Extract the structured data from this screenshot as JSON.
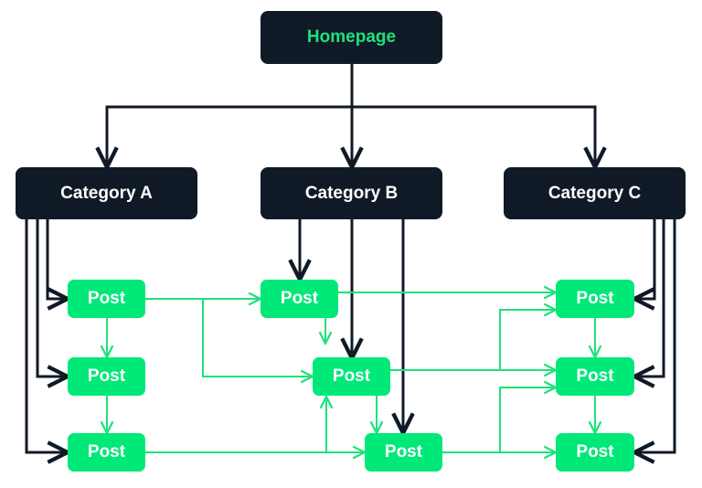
{
  "colors": {
    "dark": "#101a27",
    "green": "#00e878",
    "home_text": "#1ee27a"
  },
  "nodes": {
    "homepage": "Homepage",
    "category_a": "Category A",
    "category_b": "Category B",
    "category_c": "Category C",
    "post_label": "Post"
  },
  "posts": [
    {
      "id": "a1",
      "label": "Post"
    },
    {
      "id": "a2",
      "label": "Post"
    },
    {
      "id": "a3",
      "label": "Post"
    },
    {
      "id": "b1",
      "label": "Post"
    },
    {
      "id": "b2",
      "label": "Post"
    },
    {
      "id": "b3",
      "label": "Post"
    },
    {
      "id": "c1",
      "label": "Post"
    },
    {
      "id": "c2",
      "label": "Post"
    },
    {
      "id": "c3",
      "label": "Post"
    }
  ]
}
